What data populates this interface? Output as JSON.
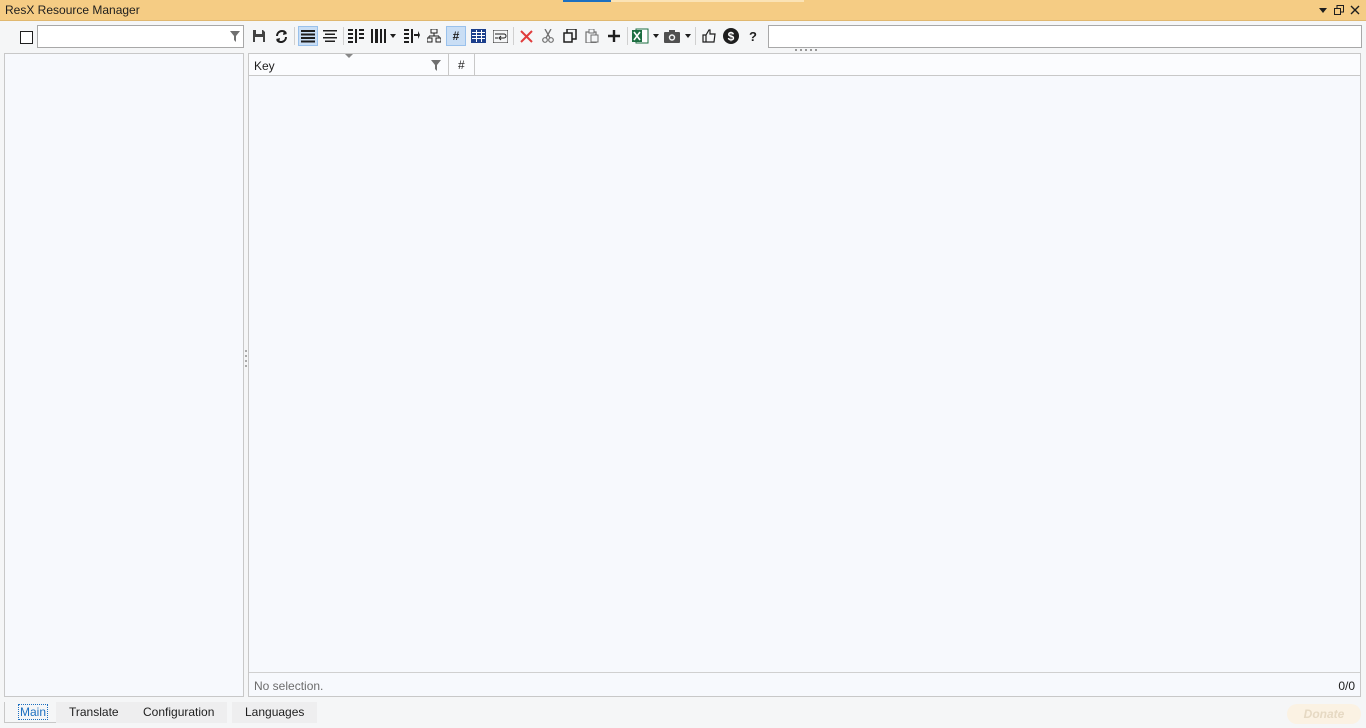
{
  "window": {
    "title": "ResX Resource Manager"
  },
  "toolbar": {
    "filter_placeholder": "",
    "search_placeholder": ""
  },
  "grid": {
    "columns": [
      {
        "label": "Key"
      },
      {
        "label": "#"
      }
    ],
    "status_left": "No selection.",
    "status_right": "0/0"
  },
  "tabs": [
    {
      "label": "Main",
      "selected": true
    },
    {
      "label": "Translate",
      "selected": false
    },
    {
      "label": "Configuration",
      "selected": false
    },
    {
      "label": "Languages",
      "selected": false
    }
  ],
  "donate_label": "Donate",
  "colors": {
    "titlebar": "#f5cc84",
    "accent": "#1c6fc0",
    "delete_red": "#e03c3c",
    "excel_green": "#1d6f42"
  }
}
